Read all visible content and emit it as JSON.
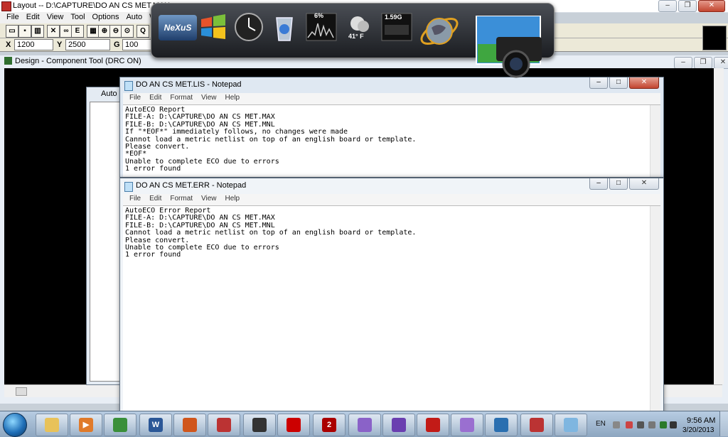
{
  "app": {
    "title": "Layout -- D:\\CAPTURE\\DO AN CS MET.MAX",
    "menu": [
      "File",
      "Edit",
      "View",
      "Tool",
      "Options",
      "Auto",
      "Win"
    ],
    "toolbar_icons": [
      "open-icon",
      "save-icon",
      "chart-icon",
      "x-icon",
      "binoculars-icon",
      "e-icon",
      "grid-icon",
      "zoom-in-icon",
      "zoom-out-icon",
      "zoom-fit-icon",
      "q-icon"
    ],
    "toolbar_letters": {
      "e": "E",
      "q": "Q"
    },
    "coords": {
      "x_label": "X",
      "x_value": "1200",
      "y_label": "Y",
      "y_value": "2500",
      "g_label": "G",
      "g_value": "100"
    }
  },
  "design_window": {
    "title": "Design - Component Tool (DRC ON)"
  },
  "auto_window": {
    "title": "Auto"
  },
  "notepad_lis": {
    "title": "DO AN CS MET.LIS - Notepad",
    "menu": [
      "File",
      "Edit",
      "Format",
      "View",
      "Help"
    ],
    "content": "AutoECO Report\nFILE-A: D:\\CAPTURE\\DO AN CS MET.MAX\nFILE-B: D:\\CAPTURE\\DO AN CS MET.MNL\nIf \"*EOF*\" immediately follows, no changes were made\nCannot load a metric netlist on top of an english board or template.\nPlease convert.\n*EOF*\nUnable to complete ECO due to errors\n1 error found"
  },
  "notepad_err": {
    "title": "DO AN CS MET.ERR - Notepad",
    "menu": [
      "File",
      "Edit",
      "Format",
      "View",
      "Help"
    ],
    "content": "AutoECO Error Report\nFILE-A: D:\\CAPTURE\\DO AN CS MET.MAX\nFILE-B: D:\\CAPTURE\\DO AN CS MET.MNL\nCannot load a metric netlist on top of an english board or template.\nPlease convert.\nUnable to complete ECO due to errors\n1 error found"
  },
  "gadgets": {
    "logo": "NeXuS",
    "cpu_label": "6%",
    "weather": "41° F",
    "memory_label": "1.59G"
  },
  "taskbar": {
    "items": [
      {
        "name": "explorer-icon",
        "glyph": "",
        "color": "#e8c25a"
      },
      {
        "name": "media-player-icon",
        "glyph": "▶",
        "color": "#e07a2a"
      },
      {
        "name": "chrome-icon",
        "glyph": "",
        "color": "#3a8f3a"
      },
      {
        "name": "word-icon",
        "glyph": "W",
        "color": "#2b5797"
      },
      {
        "name": "firefox-icon",
        "glyph": "",
        "color": "#d0561c"
      },
      {
        "name": "layout-app-icon",
        "glyph": "",
        "color": "#b33"
      },
      {
        "name": "guitar-pick-icon",
        "glyph": "",
        "color": "#333"
      },
      {
        "name": "microchip-icon",
        "glyph": "",
        "color": "#c00"
      },
      {
        "name": "pickit-icon",
        "glyph": "2",
        "color": "#a00"
      },
      {
        "name": "messenger-icon",
        "glyph": "",
        "color": "#8a62c8"
      },
      {
        "name": "visual-studio-icon",
        "glyph": "",
        "color": "#6a3fb0"
      },
      {
        "name": "acrobat-icon",
        "glyph": "",
        "color": "#c21b17"
      },
      {
        "name": "messenger2-icon",
        "glyph": "",
        "color": "#9a6fd0"
      },
      {
        "name": "capture-icon",
        "glyph": "",
        "color": "#2a6fb0"
      },
      {
        "name": "layout2-icon",
        "glyph": "",
        "color": "#b33"
      },
      {
        "name": "notepad-icon",
        "glyph": "",
        "color": "#7fb6e0"
      }
    ],
    "language": "EN",
    "time": "9:56 AM",
    "date": "3/20/2013"
  }
}
